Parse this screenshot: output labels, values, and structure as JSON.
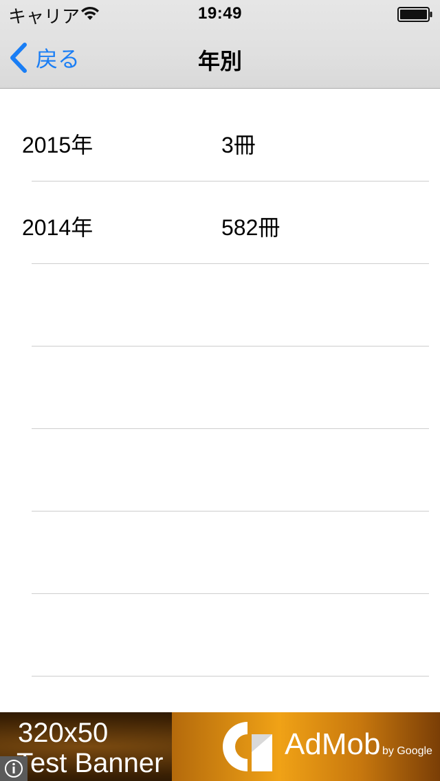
{
  "status_bar": {
    "carrier": "キャリア",
    "time": "19:49",
    "icons": [
      "wifi-icon",
      "battery-icon"
    ]
  },
  "nav": {
    "back_label": "戻る",
    "title": "年別",
    "back_icon": "chevron-left-icon",
    "accent_color": "#1a7ef5"
  },
  "list": {
    "rows": [
      {
        "year": "2015年",
        "count": "3冊"
      },
      {
        "year": "2014年",
        "count": "582冊"
      },
      {
        "year": "",
        "count": ""
      },
      {
        "year": "",
        "count": ""
      },
      {
        "year": "",
        "count": ""
      },
      {
        "year": "",
        "count": ""
      },
      {
        "year": "",
        "count": ""
      }
    ]
  },
  "banner": {
    "size": "320x50",
    "label": "Test Banner",
    "brand": "AdMob",
    "by": "by Google",
    "icons": [
      "admob-logo-icon",
      "info-icon"
    ]
  }
}
